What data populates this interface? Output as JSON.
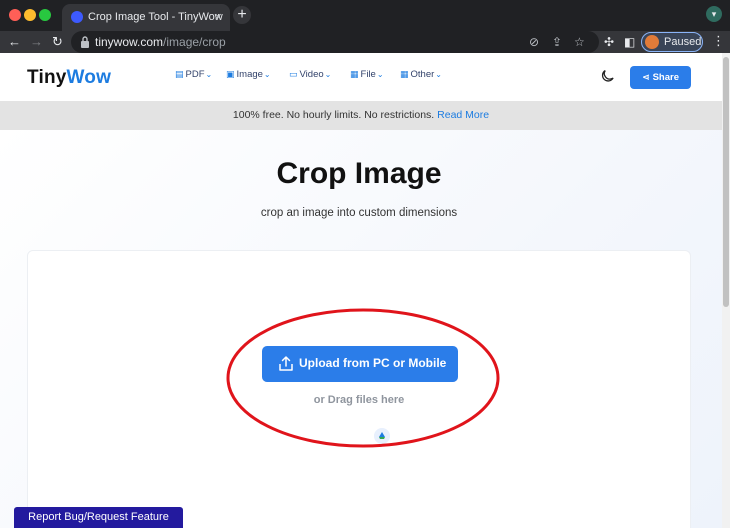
{
  "browser": {
    "tab_title": "Crop Image Tool - TinyWow",
    "url_host": "tinywow.com",
    "url_path": "/image/crop",
    "profile_status": "Paused"
  },
  "header": {
    "logo_tiny": "Tiny",
    "logo_wow": "Wow",
    "menu": [
      "PDF",
      "Image",
      "Video",
      "File",
      "Other"
    ],
    "share_label": "Share"
  },
  "promo": {
    "text": "100% free. No hourly limits. No restrictions.",
    "link": "Read More"
  },
  "main": {
    "title": "Crop Image",
    "subtitle": "crop an image into custom dimensions",
    "upload_label": "Upload from PC or Mobile",
    "drag_text": "or Drag files here"
  },
  "footer": {
    "report_label": "Report Bug/Request Feature"
  },
  "colors": {
    "accent": "#2b7de9",
    "report_bg": "#231a9e",
    "annotation": "#e0141b"
  }
}
